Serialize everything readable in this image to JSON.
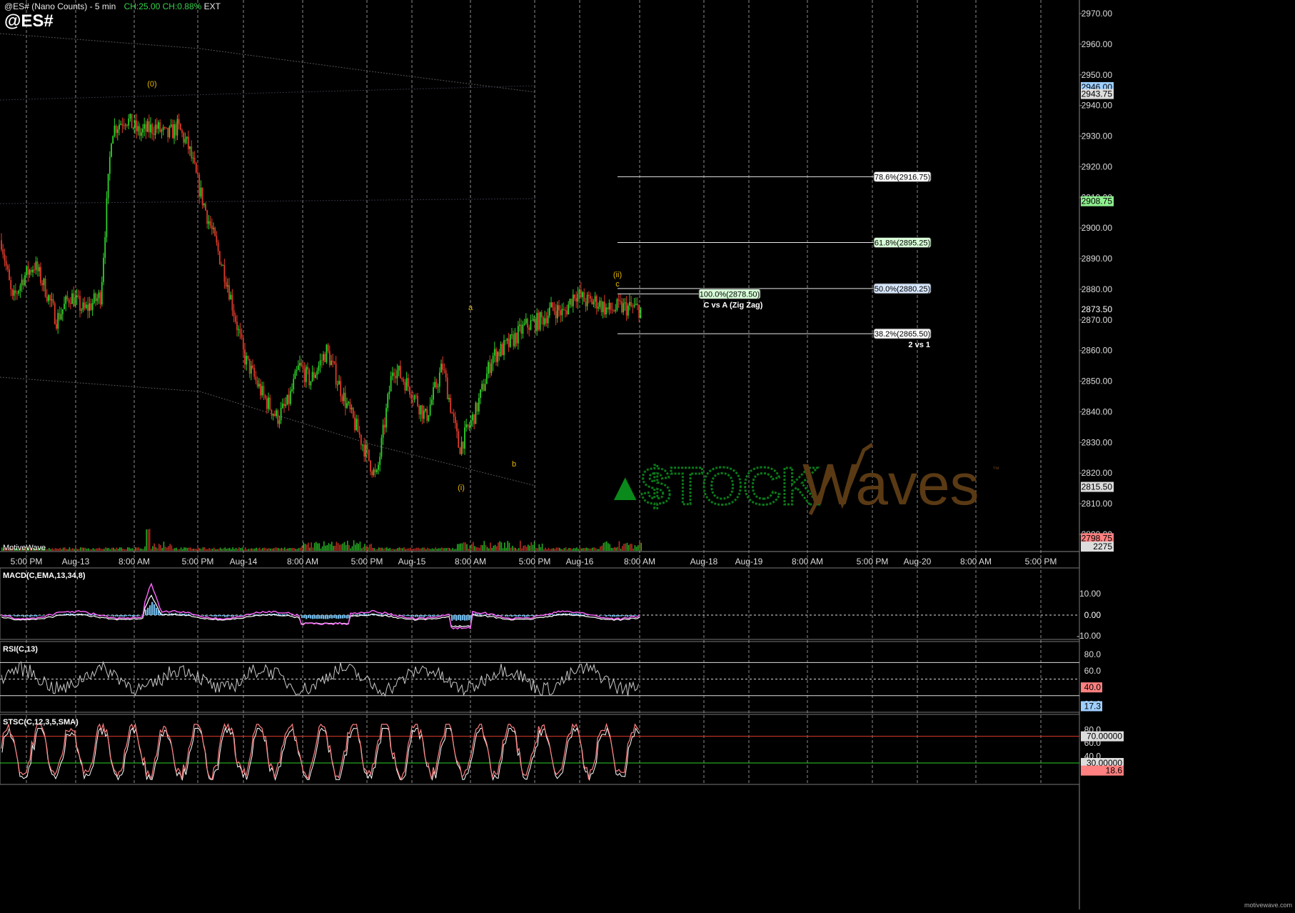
{
  "header": {
    "title": "@ES# (Nano Counts) - 5 min",
    "change": "CH:25.00 CH:0.88%",
    "session": "EXT",
    "symbol": "@ES#"
  },
  "colors": {
    "background": "#000000",
    "bullish": "#2ed12a",
    "bearish": "#e03a2a",
    "wave_label": "#e6b800",
    "fib_line": "#e8e8e8",
    "channel": "#555555",
    "macd_line": "#ff66ff",
    "macd_signal": "#ffffff",
    "macd_hist": "#6fb7e6",
    "rsi_line": "#c8c8c8",
    "stoch_k": "#ff8080",
    "stoch_d": "#ffffff",
    "watermark_green": "#0a7a1a",
    "watermark_brown": "#5a3a14"
  },
  "price_axis": {
    "min": 2800,
    "max": 2975,
    "ticks": [
      "2970.00",
      "2960.00",
      "2950.00",
      "2940.00",
      "2930.00",
      "2920.00",
      "2910.00",
      "2900.00",
      "2890.00",
      "2880.00",
      "2870.00",
      "2860.00",
      "2850.00",
      "2840.00",
      "2830.00",
      "2820.00",
      "2810.00",
      "2800.00"
    ],
    "tags": [
      {
        "label": "2946.00",
        "price": 2946.0,
        "bg": "#9ecfff",
        "fg": "#000"
      },
      {
        "label": "2943.75",
        "price": 2943.75,
        "bg": "#dddddd",
        "fg": "#000"
      },
      {
        "label": "2908.75",
        "price": 2908.75,
        "bg": "#8ff08f",
        "fg": "#000"
      },
      {
        "label": "2873.50",
        "price": 2873.5,
        "bg": "#000000",
        "fg": "#ffffff"
      },
      {
        "label": "2815.50",
        "price": 2815.5,
        "bg": "#dddddd",
        "fg": "#000"
      },
      {
        "label": "2798.75",
        "price": 2798.75,
        "bg": "#ff8080",
        "fg": "#000"
      },
      {
        "label": "2275",
        "price": 2796.0,
        "bg": "#dddddd",
        "fg": "#000"
      }
    ]
  },
  "time_axis": [
    {
      "label": "5:00 PM",
      "x": 37
    },
    {
      "label": "Aug-13",
      "x": 106
    },
    {
      "label": "8:00 AM",
      "x": 188
    },
    {
      "label": "5:00 PM",
      "x": 277
    },
    {
      "label": "Aug-14",
      "x": 341
    },
    {
      "label": "8:00 AM",
      "x": 424
    },
    {
      "label": "5:00 PM",
      "x": 514
    },
    {
      "label": "Aug-15",
      "x": 577
    },
    {
      "label": "8:00 AM",
      "x": 659
    },
    {
      "label": "5:00 PM",
      "x": 749
    },
    {
      "label": "Aug-16",
      "x": 812
    },
    {
      "label": "8:00 AM",
      "x": 896
    },
    {
      "label": "Aug-18",
      "x": 986
    },
    {
      "label": "Aug-19",
      "x": 1049
    },
    {
      "label": "8:00 AM",
      "x": 1131
    },
    {
      "label": "5:00 PM",
      "x": 1222
    },
    {
      "label": "Aug-20",
      "x": 1285
    },
    {
      "label": "8:00 AM",
      "x": 1367
    },
    {
      "label": "5:00 PM",
      "x": 1458
    }
  ],
  "fib_levels": [
    {
      "label": "78.6%(2916.75)",
      "price": 2916.75,
      "bg": "#ffffff"
    },
    {
      "label": "61.8%(2895.25)",
      "price": 2895.25,
      "bg": "#d8ffd8"
    },
    {
      "label": "50.0%(2880.25)",
      "price": 2880.25,
      "bg": "#d8e8ff"
    },
    {
      "label": "38.2%(2865.50)",
      "price": 2865.5,
      "bg": "#ffffff"
    }
  ],
  "fib_note": "2 vs 1",
  "zigzag": {
    "label": "100.0%(2878.50)",
    "price": 2878.5,
    "note": "C vs A (Zig Zag)"
  },
  "wave_labels": [
    {
      "text": "(0)",
      "x": 213,
      "y": 117
    },
    {
      "text": "(ii)",
      "x": 865,
      "y": 384
    },
    {
      "text": "c",
      "x": 865,
      "y": 397
    },
    {
      "text": "a",
      "x": 659,
      "y": 430
    },
    {
      "text": "b",
      "x": 720,
      "y": 649
    },
    {
      "text": "(i)",
      "x": 646,
      "y": 682
    }
  ],
  "watermark": {
    "mark": "▲",
    "brand1": "$TOCK",
    "brand2": "Waves",
    "tm": "™"
  },
  "platform_label": "MotiveWave",
  "footer_url": "motivewave.com",
  "macd": {
    "label": "MACD(C,EMA,13,34,8)",
    "ticks": [
      "10.00",
      "0.00",
      "-10.00"
    ],
    "value": "0.00"
  },
  "rsi": {
    "label": "RSI(C,13)",
    "ticks": [
      "80.0",
      "60.0",
      "40.0",
      "20.0"
    ],
    "values": [
      {
        "label": "40.0",
        "bg": "#ff8080"
      },
      {
        "label": "17.3",
        "bg": "#9ecfff"
      }
    ]
  },
  "stoch": {
    "label": "STSC(C,12,3,5,SMA)",
    "ticks": [
      "80.0",
      "60.0",
      "40.0",
      "20.0"
    ],
    "values": [
      {
        "label": "70.00000",
        "bg": "#dddddd"
      },
      {
        "label": "30.00000",
        "bg": "#dddddd"
      },
      {
        "label": "18.6",
        "bg": "#ff8080"
      }
    ]
  },
  "chart_data": {
    "type": "line",
    "title": "@ES# (Nano Counts) - 5 min",
    "xlabel": "",
    "ylabel": "",
    "ylim": [
      2800,
      2975
    ],
    "series": [
      {
        "name": "@ES#",
        "x_index": [
          0,
          4,
          8,
          12,
          16,
          20,
          25,
          30,
          36,
          40,
          45,
          50,
          56,
          60,
          64,
          68,
          72,
          76,
          82,
          88,
          95,
          100,
          104,
          108,
          112,
          118,
          124,
          130,
          136,
          142,
          148,
          154,
          160,
          166,
          172,
          178,
          184,
          190,
          196,
          200,
          204,
          208,
          212,
          216,
          220,
          224,
          228,
          232
        ],
        "values": [
          2896,
          2876,
          2884,
          2888,
          2880,
          2870,
          2878,
          2873,
          2878,
          2932,
          2936,
          2931,
          2933,
          2930,
          2933,
          2926,
          2912,
          2900,
          2882,
          2858,
          2845,
          2838,
          2843,
          2855,
          2850,
          2860,
          2845,
          2832,
          2818,
          2855,
          2848,
          2838,
          2855,
          2828,
          2840,
          2858,
          2862,
          2868,
          2870,
          2874,
          2872,
          2879,
          2876,
          2876,
          2873,
          2874,
          2874,
          2873.5
        ]
      }
    ]
  }
}
